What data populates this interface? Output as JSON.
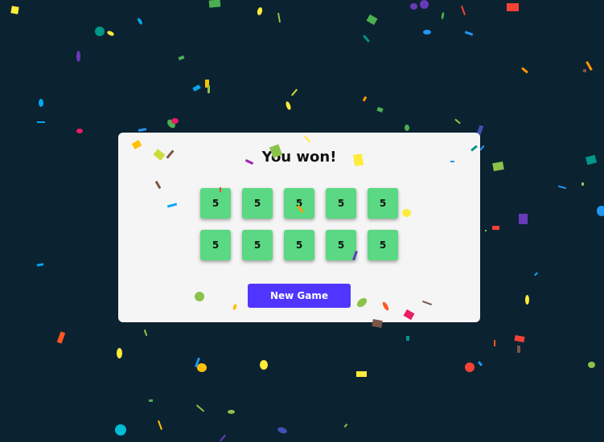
{
  "title": "You won!",
  "dice": [
    "5",
    "5",
    "5",
    "5",
    "5",
    "5",
    "5",
    "5",
    "5",
    "5"
  ],
  "new_game_label": "New Game",
  "colors": {
    "background": "#0b2231",
    "card": "#f5f5f5",
    "die": "#5ad883",
    "button": "#5035ff",
    "confetti": [
      "#f44336",
      "#e91e63",
      "#9c27b0",
      "#673ab7",
      "#3f51b5",
      "#2196f3",
      "#03a9f4",
      "#00bcd4",
      "#009688",
      "#4caf50",
      "#8bc34a",
      "#cddc39",
      "#ffeb3b",
      "#ffc107",
      "#ff9800",
      "#ff5722",
      "#795548"
    ]
  }
}
